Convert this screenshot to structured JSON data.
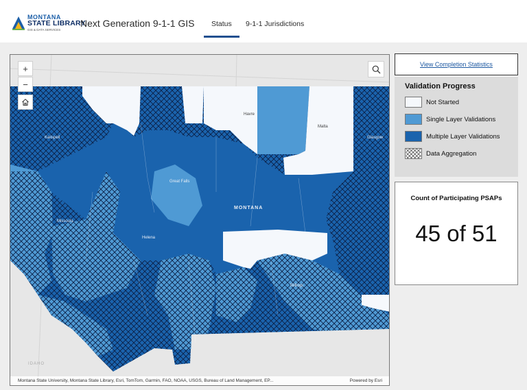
{
  "header": {
    "logo": {
      "line1": "MONTANA",
      "line2": "STATE LIBRARY",
      "line3": "GIS & DATA SERVICES"
    },
    "app_title": "Next Generation 9-1-1 GIS",
    "tabs": [
      {
        "label": "Status",
        "active": true
      },
      {
        "label": "9-1-1 Jurisdictions",
        "active": false
      }
    ]
  },
  "map": {
    "controls": {
      "zoom_in": "+",
      "zoom_out": "−",
      "home_icon": "home-icon",
      "search_icon": "search-icon"
    },
    "labels": {
      "havre": "Havre",
      "malta": "Malta",
      "kalispell": "Kalispell",
      "glasgow": "Glasgow",
      "great_falls": "Great Falls",
      "montana": "MONTANA",
      "missoula": "Missoula",
      "helena": "Helena",
      "billings": "Billings",
      "idaho": "IDAHO"
    },
    "attribution": "Montana State University, Montana State Library, Esri, TomTom, Garmin, FAO, NOAA, USGS, Bureau of Land Management, EP...",
    "powered_by": "Powered by Esri"
  },
  "panel": {
    "stats_link": "View Completion Statistics",
    "legend": {
      "title": "Validation Progress",
      "items": [
        {
          "label": "Not Started",
          "color": "#f5f8fc"
        },
        {
          "label": "Single Layer Validations",
          "color": "#4f9ad4"
        },
        {
          "label": "Multiple Layer Validations",
          "color": "#1a63ad"
        },
        {
          "label": "Data Aggregation",
          "color": "#ffffff"
        }
      ]
    },
    "count": {
      "title": "Count of Participating PSAPs",
      "value": "45 of 51"
    }
  },
  "colors": {
    "dark_blue": "#1a63ad",
    "mid_blue": "#4f9ad4",
    "light": "#f5f8fc",
    "hatch": "#0b1f44"
  }
}
